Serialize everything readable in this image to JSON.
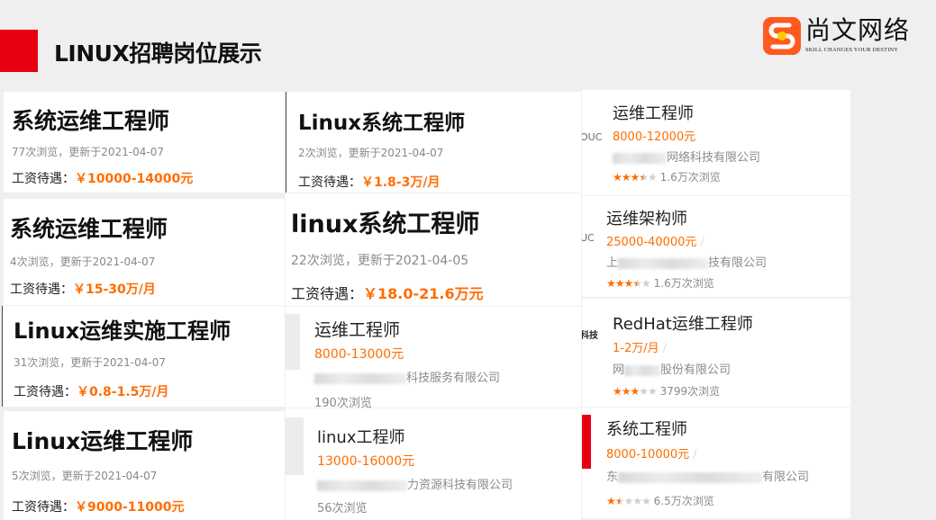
{
  "header": {
    "title": "LINUX招聘岗位展示",
    "accent_color": "#e60012"
  },
  "logo": {
    "name": "尚文网络",
    "tagline": "SKILL CHANGES YOUR DESTINY",
    "icon": "logo-s-icon"
  },
  "colors": {
    "salary": "#ff6d00",
    "meta": "#888888"
  },
  "left_cards": [
    {
      "title": "系统运维工程师",
      "meta": "77次浏览，更新于2021-04-07",
      "pay_label": "工资待遇：",
      "pay_value": "￥10000-14000元"
    },
    {
      "title": "系统运维工程师",
      "meta": "4次浏览，更新于2021-04-07",
      "pay_label": "工资待遇：",
      "pay_value": "￥15-30万/月"
    },
    {
      "title": "Linux运维实施工程师",
      "meta": "31次浏览，更新于2021-04-07",
      "pay_label": "工资待遇：",
      "pay_value": "￥0.8-1.5万/月"
    },
    {
      "title": "Linux运维工程师",
      "meta": "5次浏览，更新于2021-04-07",
      "pay_label": "工资待遇：",
      "pay_value": "￥9000-11000元"
    }
  ],
  "mid_cards": [
    {
      "title": "Linux系统工程师",
      "meta": "2次浏览，更新于2021-04-07",
      "pay_label": "工资待遇：",
      "pay_value": "￥1.8-3万/月"
    },
    {
      "title": "linux系统工程师",
      "meta": "22次浏览，更新于2021-04-05",
      "pay_label": "工资待遇：",
      "pay_value": "￥18.0-21.6万元"
    }
  ],
  "mid_jobs": [
    {
      "title": "运维工程师",
      "salary": "8000-13000元",
      "company_suffix": "科技服务有限公司",
      "views": "190次浏览"
    },
    {
      "title": "linux工程师",
      "salary": "13000-16000元",
      "company_suffix": "力资源科技有限公司",
      "views": "56次浏览"
    }
  ],
  "right_jobs": [
    {
      "thumb_text": "OUC",
      "title": "运维工程师",
      "salary": "8000-12000元",
      "company_prefix": "",
      "company_suffix": "网络科技有限公司",
      "rating": 3.5,
      "views": "1.6万次浏览"
    },
    {
      "thumb_text": "UC",
      "title": "运维架构师",
      "salary": "25000-40000元",
      "company_prefix": "上",
      "company_suffix": "技有限公司",
      "rating": 3.5,
      "views": "1.6万次浏览"
    },
    {
      "thumb_text": "科技",
      "title": "RedHat运维工程师",
      "salary": "1-2万/月",
      "company_prefix": "网",
      "company_suffix": "股份有限公司",
      "rating": 3,
      "views": "3799次浏览"
    },
    {
      "thumb_text": "",
      "title": "系统工程师",
      "salary": "8000-10000元",
      "company_prefix": "东",
      "company_suffix": "有限公司",
      "rating": 1.5,
      "views": "6.5万次浏览"
    }
  ]
}
